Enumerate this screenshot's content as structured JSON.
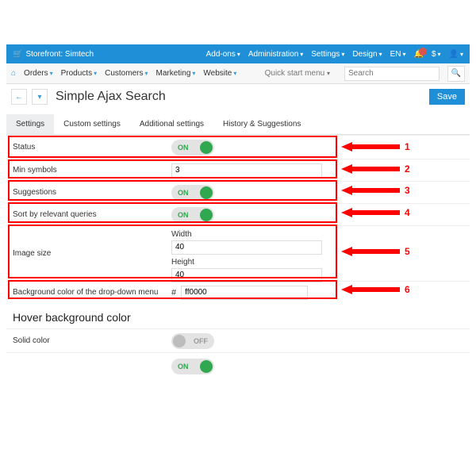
{
  "topbar": {
    "cart_icon": "🛒",
    "storefront": "Storefront: Simtech",
    "addons": "Add-ons",
    "admin": "Administration",
    "settings": "Settings",
    "design": "Design",
    "lang": "EN",
    "currency": "$"
  },
  "nav": {
    "orders": "Orders",
    "products": "Products",
    "customers": "Customers",
    "marketing": "Marketing",
    "website": "Website",
    "quick": "Quick start menu",
    "search_ph": "Search"
  },
  "title": {
    "page": "Simple Ajax Search",
    "save": "Save"
  },
  "tabs": {
    "t1": "Settings",
    "t2": "Custom settings",
    "t3": "Additional settings",
    "t4": "History & Suggestions"
  },
  "rows": {
    "status": "Status",
    "on": "ON",
    "off": "OFF",
    "min_symbols": "Min symbols",
    "min_symbols_val": "3",
    "suggestions": "Suggestions",
    "sort": "Sort by relevant queries",
    "img": "Image size",
    "width": "Width",
    "width_val": "40",
    "height": "Height",
    "height_val": "40",
    "bg": "Background color of the drop-down menu",
    "hash": "#",
    "bg_val": "ff0000",
    "hover_title": "Hover background color",
    "solid": "Solid color"
  },
  "annos": {
    "n1": "1",
    "n2": "2",
    "n3": "3",
    "n4": "4",
    "n5": "5",
    "n6": "6"
  }
}
